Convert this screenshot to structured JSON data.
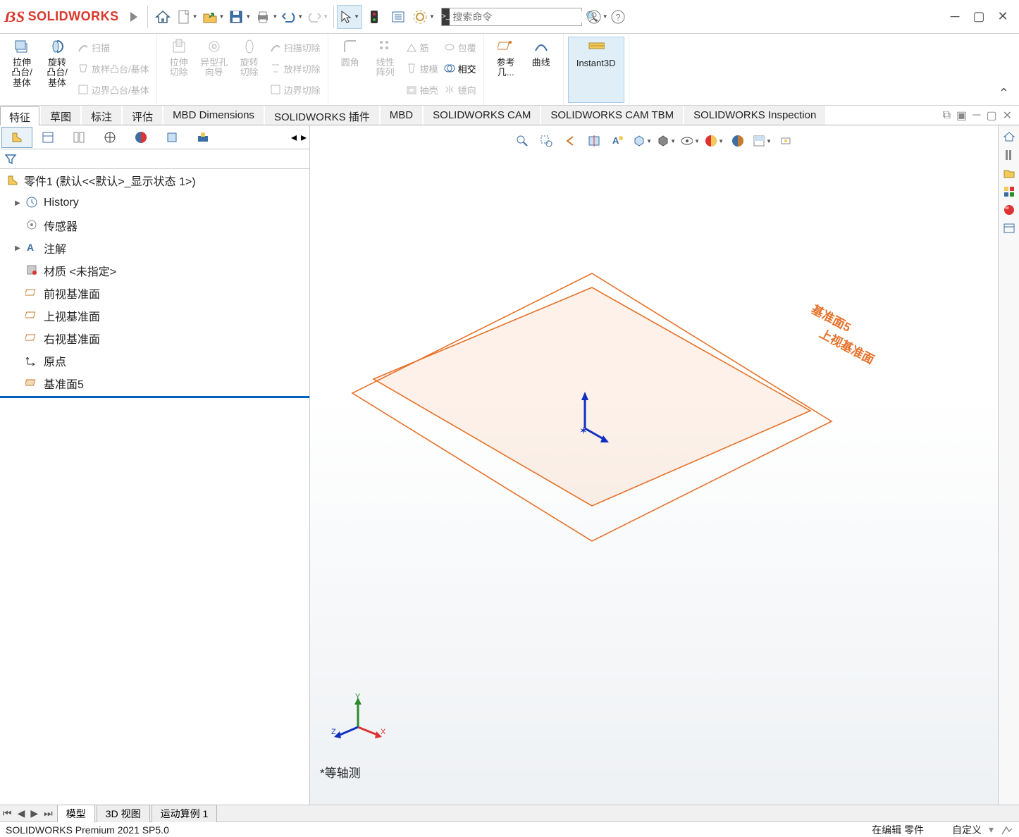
{
  "app_name": "SOLIDWORKS",
  "search_placeholder": "搜索命令",
  "ribbon": {
    "extrude_boss": "拉伸\n凸台/\n基体",
    "revolve_boss": "旋转\n凸台/\n基体",
    "sweep": "扫描",
    "loft_boss": "放样凸台/基体",
    "boundary_boss": "边界凸台/基体",
    "cut_extrude": "拉伸\n切除",
    "hole_wizard": "异型孔\n向导",
    "cut_revolve": "旋转\n切除",
    "sweep_cut": "扫描切除",
    "loft_cut": "放样切除",
    "boundary_cut": "边界切除",
    "fillet": "圆角",
    "linear_pattern": "线性\n阵列",
    "rib": "筋",
    "draft": "拔模",
    "shell": "抽壳",
    "wrap": "包覆",
    "intersect": "相交",
    "mirror": "镜向",
    "ref_geom": "参考\n几...",
    "curves": "曲线",
    "instant3d": "Instant3D"
  },
  "cm_tabs": [
    "特征",
    "草图",
    "标注",
    "评估",
    "MBD Dimensions",
    "SOLIDWORKS 插件",
    "MBD",
    "SOLIDWORKS CAM",
    "SOLIDWORKS CAM TBM",
    "SOLIDWORKS Inspection"
  ],
  "tree": {
    "root": "零件1  (默认<<默认>_显示状态 1>)",
    "items": [
      {
        "label": "History"
      },
      {
        "label": "传感器"
      },
      {
        "label": "注解"
      },
      {
        "label": "材质 <未指定>"
      },
      {
        "label": "前视基准面"
      },
      {
        "label": "上视基准面"
      },
      {
        "label": "右视基准面"
      },
      {
        "label": "原点"
      },
      {
        "label": "基准面5"
      }
    ]
  },
  "plane_labels": [
    "基准面5",
    "上视基准面"
  ],
  "triad_axes": [
    "X",
    "Y",
    "Z"
  ],
  "view_name": "*等轴测",
  "bottom_tabs": [
    "模型",
    "3D 视图",
    "运动算例 1"
  ],
  "status": {
    "product": "SOLIDWORKS Premium 2021 SP5.0",
    "edit_state": "在编辑 零件",
    "ui_mode": "自定义"
  },
  "plane_color": "#e77128",
  "selected_color": "#0060c0"
}
